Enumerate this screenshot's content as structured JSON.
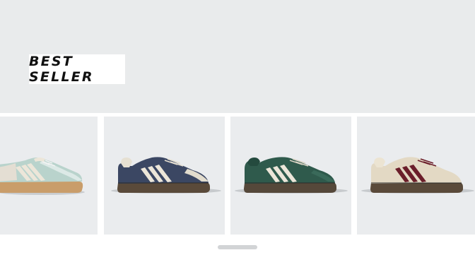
{
  "hero": {
    "badge_label": "BEST SELLER",
    "background_color": "#e9ebec"
  },
  "carousel": {
    "items": [
      {
        "name": "shoe-mint-silver",
        "upper_color": "#b9d3cc",
        "stripe_color": "#ece6d9",
        "sole_color": "#c99d6a"
      },
      {
        "name": "shoe-navy",
        "upper_color": "#3b4763",
        "stripe_color": "#ece6d9",
        "sole_color": "#5a4a3a"
      },
      {
        "name": "shoe-green",
        "upper_color": "#2f5a4c",
        "stripe_color": "#ece6d9",
        "sole_color": "#55483a"
      },
      {
        "name": "shoe-cream-burgundy",
        "upper_color": "#e3d9c4",
        "stripe_color": "#6b1e2a",
        "sole_color": "#5a4a3a"
      }
    ]
  },
  "scroll_indicator": {
    "icon": "scroll-handle"
  }
}
